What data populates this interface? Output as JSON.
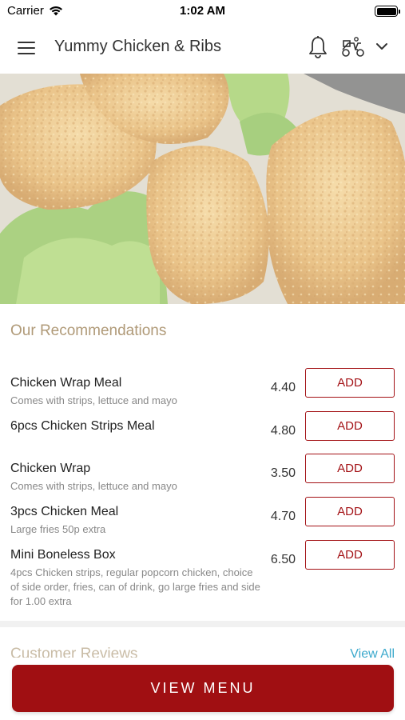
{
  "status_bar": {
    "carrier": "Carrier",
    "time": "1:02 AM"
  },
  "header": {
    "title": "Yummy Chicken & Ribs"
  },
  "recommendations": {
    "title": "Our Recommendations",
    "add_label": "ADD",
    "items": [
      {
        "name": "Chicken Wrap Meal",
        "description": "Comes with strips, lettuce and mayo",
        "price": "4.40"
      },
      {
        "name": "6pcs Chicken Strips Meal",
        "description": "",
        "price": "4.80"
      },
      {
        "name": "Chicken Wrap",
        "description": "Comes with strips, lettuce and mayo",
        "price": "3.50"
      },
      {
        "name": "3pcs Chicken Meal",
        "description": "Large fries 50p extra",
        "price": "4.70"
      },
      {
        "name": "Mini Boneless Box",
        "description": "4pcs Chicken strips, regular popcorn chicken, choice of side order, fries, can of drink, go large fries and side for 1.00 extra",
        "price": "6.50"
      }
    ]
  },
  "reviews": {
    "title": "Customer Reviews",
    "view_all": "View All"
  },
  "footer": {
    "view_menu": "VIEW MENU"
  },
  "colors": {
    "accent": "#a00f12",
    "link": "#3ba9cc",
    "section_title": "#b09a78"
  }
}
